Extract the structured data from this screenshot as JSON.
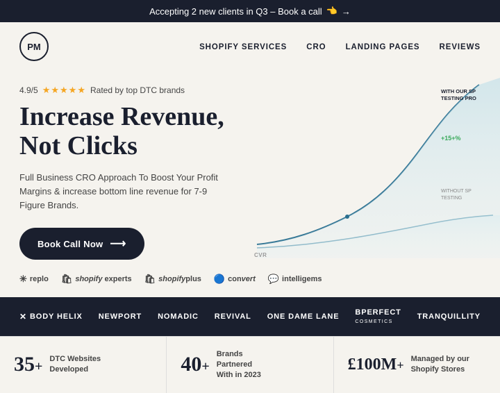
{
  "banner": {
    "text": "Accepting 2 new clients in Q3 – Book a call",
    "emoji": "👈",
    "arrow": "→"
  },
  "nav": {
    "logo": "PM",
    "links": [
      {
        "label": "SHOPIFY SERVICES",
        "id": "shopify-services"
      },
      {
        "label": "CRO",
        "id": "cro"
      },
      {
        "label": "LANDING PAGES",
        "id": "landing-pages"
      },
      {
        "label": "REVIEWS",
        "id": "reviews"
      }
    ]
  },
  "hero": {
    "rating_score": "4.9/5",
    "rating_text": "Rated by top DTC brands",
    "stars": "★★★★★",
    "title_line1": "Increase Revenue,",
    "title_line2": "Not Clicks",
    "description": "Full Business CRO Approach To Boost Your Profit Margins & increase bottom line revenue for 7-9 Figure Brands.",
    "cta_label": "Book Call Now",
    "cta_arrow": "⟶",
    "chart": {
      "with_label": "WITH OUR SP TESTING PRO",
      "pct_label": "+15+%",
      "without_label": "WITHOUT SP TESTING",
      "cvr_label": "CVR"
    }
  },
  "partners": [
    {
      "name": "replo",
      "icon": "✳"
    },
    {
      "name": "shopify experts",
      "icon": "🛒"
    },
    {
      "name": "shopify plus",
      "icon": "🛒"
    },
    {
      "name": "convert",
      "icon": "🔵"
    },
    {
      "name": "intelligems",
      "icon": "💬"
    }
  ],
  "brands": [
    {
      "name": "body helix",
      "prefix": "✕"
    },
    {
      "name": "NEWPORT",
      "prefix": ""
    },
    {
      "name": "NOMADIC",
      "prefix": ""
    },
    {
      "name": "REVIVAL",
      "prefix": ""
    },
    {
      "name": "ONE DAME LANE",
      "prefix": ""
    },
    {
      "name": "BPERFECT",
      "prefix": ""
    },
    {
      "name": "TRANQUILLITY",
      "prefix": ""
    }
  ],
  "stats": [
    {
      "number": "35+",
      "desc_line1": "DTC Websites",
      "desc_line2": "Developed"
    },
    {
      "number": "40+",
      "desc_line1": "Brands Partnered",
      "desc_line2": "With in 2023"
    },
    {
      "number": "£100M+",
      "desc_line1": "Managed by our",
      "desc_line2": "Shopify Stores"
    }
  ]
}
